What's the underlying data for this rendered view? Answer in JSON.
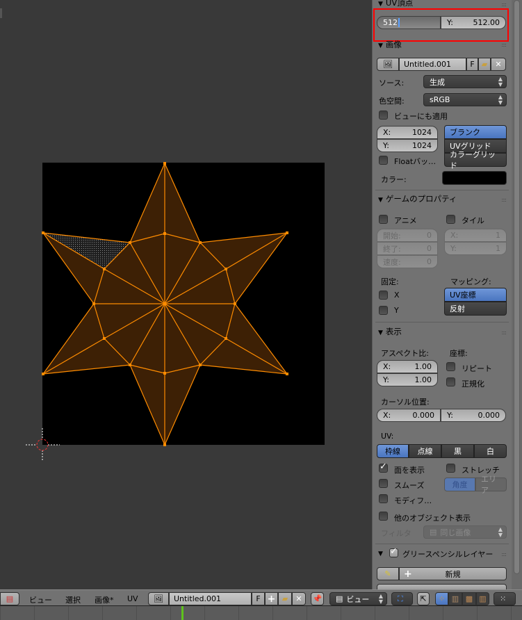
{
  "uv_vertex": {
    "title": "UV頂点",
    "x_value": "512",
    "y_label": "Y:",
    "y_value": "512.00"
  },
  "image": {
    "title": "画像",
    "name": "Untitled.001",
    "fake_user": "F",
    "source_label": "ソース:",
    "source_value": "生成",
    "colorspace_label": "色空間:",
    "colorspace_value": "sRGB",
    "view_as_render": "ビューにも適用",
    "width_label": "X:",
    "width": "1024",
    "height_label": "Y:",
    "height": "1024",
    "float_buffer": "Floatバッ…",
    "types": [
      "ブランク",
      "UVグリッド",
      "カラーグリッド"
    ],
    "selected_type": 0,
    "color_label": "カラー:",
    "color": "#000000"
  },
  "game": {
    "title": "ゲームのプロパティ",
    "animated": "アニメ",
    "tiles": "タイル",
    "start_label": "開始:",
    "start": "0",
    "end_label": "終了:",
    "end": "0",
    "speed_label": "速度:",
    "speed": "0",
    "tile_x_label": "X:",
    "tile_x": "1",
    "tile_y_label": "Y:",
    "tile_y": "1",
    "clamp_label": "固定:",
    "clamp_x": "X",
    "clamp_y": "Y",
    "mapping_label": "マッピング:",
    "mapping": [
      "UV座標",
      "反射"
    ],
    "selected_mapping": 0
  },
  "display": {
    "title": "表示",
    "aspect_label": "アスペクト比:",
    "aspect_x_label": "X:",
    "aspect_x": "1.00",
    "aspect_y_label": "Y:",
    "aspect_y": "1.00",
    "coords_label": "座標:",
    "repeat": "リピート",
    "normalized": "正規化",
    "cursor_label": "カーソル位置:",
    "cursor_x_label": "X:",
    "cursor_x": "0.000",
    "cursor_y_label": "Y:",
    "cursor_y": "0.000",
    "uv_label": "UV:",
    "uv_styles": [
      "枠線",
      "点線",
      "黒",
      "白"
    ],
    "selected_uv_style": 0,
    "draw_faces": "面を表示",
    "draw_faces_checked": true,
    "stretch": "ストレッチ",
    "smooth": "スムーズ",
    "stretch_modes": [
      "角度",
      "エリア"
    ],
    "modified": "モディフ…",
    "other_objects": "他のオブジェクト表示",
    "filter_label": "フィルタ",
    "filter_value": "同じ画像"
  },
  "grease_pencil": {
    "title": "グリースペンシルレイヤー",
    "checked": true,
    "new_label": "新規"
  },
  "header": {
    "menus": [
      "ビュー",
      "選択",
      "画像*",
      "UV"
    ],
    "image_name": "Untitled.001",
    "fake_user": "F",
    "mode": "ビュー"
  },
  "colors": {
    "accent": "#5680c2",
    "uv_edge": "#ff8c00",
    "uv_face": "#3d2005",
    "panel": "#727272",
    "viewport": "#393939",
    "highlight_box": "#ff0000",
    "frame_marker": "#5fc21c"
  }
}
